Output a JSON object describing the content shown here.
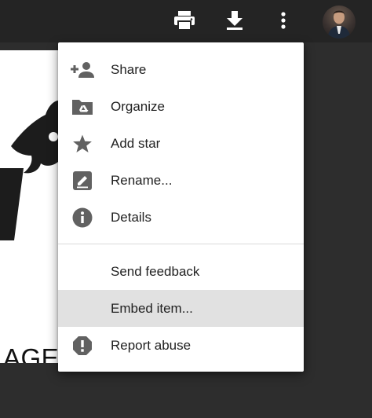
{
  "toolbar": {
    "print_icon": "print-icon",
    "download_icon": "download-icon",
    "more_icon": "more-vert-icon",
    "avatar": "user-avatar"
  },
  "document": {
    "visible_text": "AGE"
  },
  "menu": {
    "items": [
      {
        "label": "Share",
        "icon": "person-add-icon"
      },
      {
        "label": "Organize",
        "icon": "drive-folder-icon"
      },
      {
        "label": "Add star",
        "icon": "star-icon"
      },
      {
        "label": "Rename...",
        "icon": "edit-icon"
      },
      {
        "label": "Details",
        "icon": "info-icon"
      },
      {
        "label": "Send feedback",
        "icon": ""
      },
      {
        "label": "Embed item...",
        "icon": "",
        "highlighted": true
      },
      {
        "label": "Report abuse",
        "icon": "report-icon"
      }
    ]
  },
  "colors": {
    "background": "#2d2d2d",
    "topbar": "#242424",
    "menu_bg": "#ffffff",
    "menu_hover": "#e1e1e1",
    "icon_gray": "#616161",
    "text": "#212121"
  }
}
